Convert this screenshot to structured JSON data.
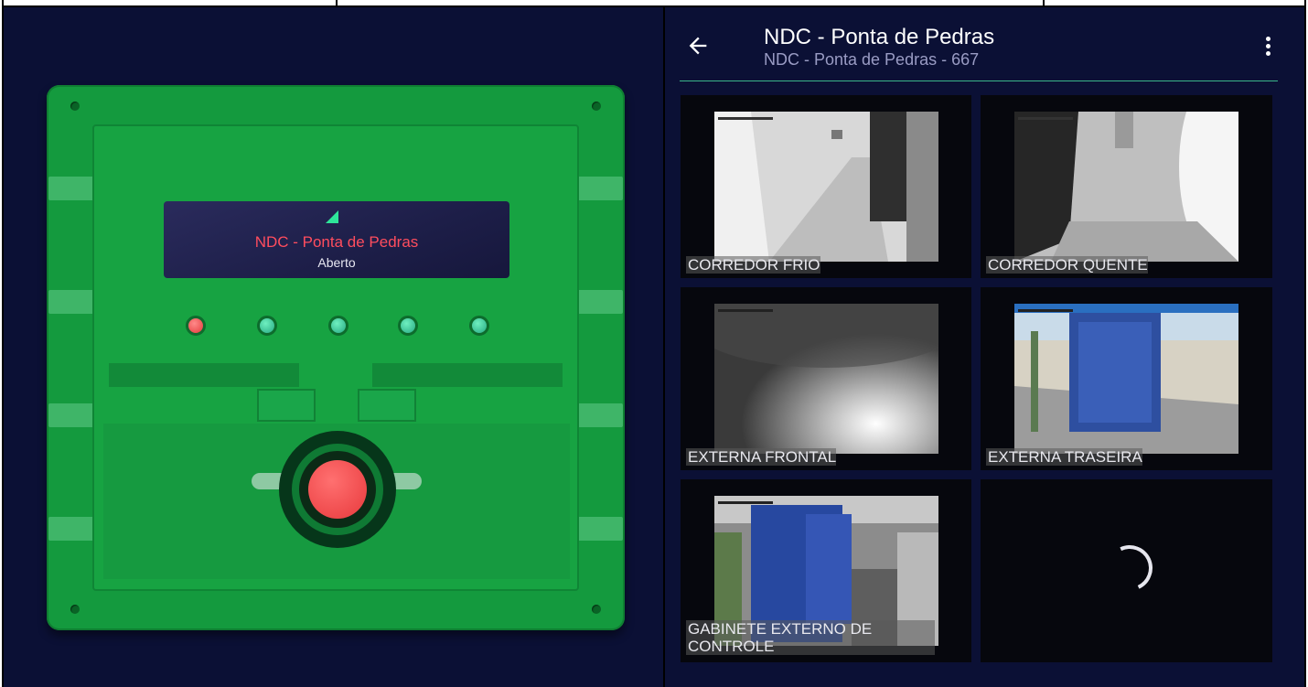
{
  "panel": {
    "display_name": "NDC - Ponta de Pedras",
    "display_status": "Aberto",
    "leds": [
      "red",
      "green",
      "green",
      "green",
      "green"
    ]
  },
  "header": {
    "title": "NDC - Ponta de Pedras",
    "subtitle": "NDC - Ponta de Pedras - 667",
    "back_icon": "arrow-left-icon",
    "menu_icon": "more-vertical-icon"
  },
  "cameras": [
    {
      "label": "CORREDOR FRIO"
    },
    {
      "label": "CORREDOR QUENTE"
    },
    {
      "label": "EXTERNA FRONTAL"
    },
    {
      "label": "EXTERNA TRASEIRA"
    },
    {
      "label": "GABINETE EXTERNO DE CONTROLE"
    }
  ],
  "colors": {
    "background": "#0b1035",
    "panel_green": "#149a3e",
    "accent": "#3bb58a",
    "alarm_red": "#e8393c"
  }
}
